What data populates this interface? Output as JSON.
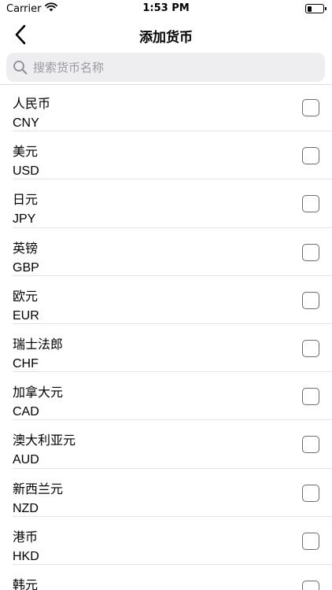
{
  "status": {
    "carrier": "Carrier",
    "time": "1:53 PM",
    "battery_level": 0.3
  },
  "nav": {
    "title": "添加货币",
    "back_icon": "chevron-left-icon"
  },
  "search": {
    "placeholder": "搜索货币名称",
    "value": ""
  },
  "currencies": [
    {
      "name": "人民币",
      "code": "CNY",
      "checked": false
    },
    {
      "name": "美元",
      "code": "USD",
      "checked": false
    },
    {
      "name": "日元",
      "code": "JPY",
      "checked": false
    },
    {
      "name": "英镑",
      "code": "GBP",
      "checked": false
    },
    {
      "name": "欧元",
      "code": "EUR",
      "checked": false
    },
    {
      "name": "瑞士法郎",
      "code": "CHF",
      "checked": false
    },
    {
      "name": "加拿大元",
      "code": "CAD",
      "checked": false
    },
    {
      "name": "澳大利亚元",
      "code": "AUD",
      "checked": false
    },
    {
      "name": "新西兰元",
      "code": "NZD",
      "checked": false
    },
    {
      "name": "港币",
      "code": "HKD",
      "checked": false
    },
    {
      "name": "韩元",
      "code": "",
      "checked": false
    }
  ]
}
